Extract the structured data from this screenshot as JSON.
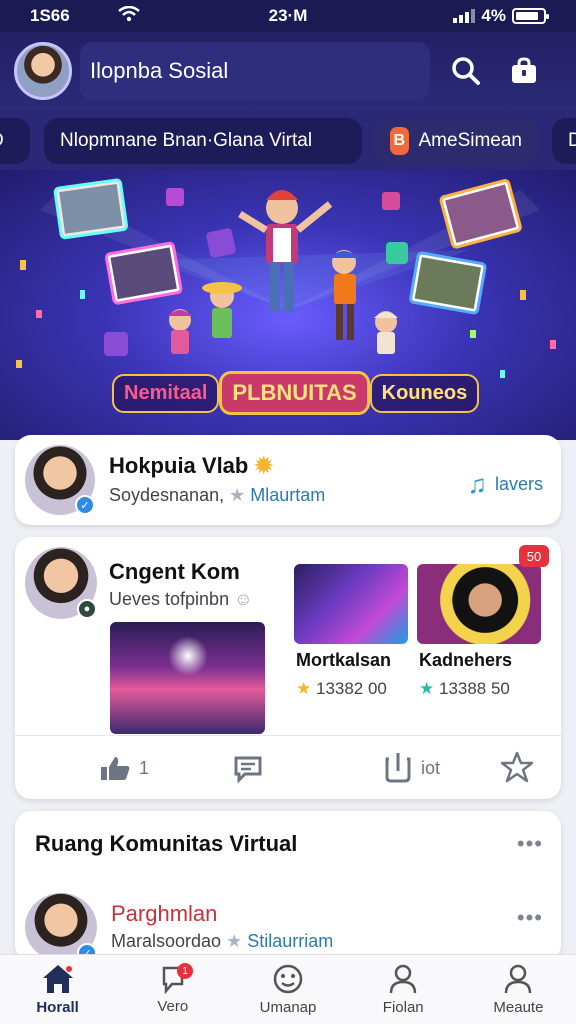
{
  "status": {
    "time": "1S66",
    "center": "23·M",
    "battery": "4%",
    "battery_level": 0.85
  },
  "header": {
    "search_text": "Ilopnba Sosial"
  },
  "chips": [
    {
      "label": "D"
    },
    {
      "label": "Nlopmnane Bnan·Glana Virtal"
    },
    {
      "label": "AmeSimean",
      "icon_text": "B"
    },
    {
      "label": "D"
    }
  ],
  "banner": {
    "left": "Nemitaal",
    "center": "PLBNUITAS",
    "right": "Kouneos"
  },
  "card1": {
    "name": "Hokpuia Vlab",
    "sub_a": "Soydesnanan,",
    "sub_b": "Mlaurtam",
    "action": "lavers"
  },
  "card2": {
    "name": "Cngent Kom",
    "sub": "Ueves tofpinbn",
    "badge": "50",
    "tiles": [
      {
        "label": "Mortkalsan",
        "stat": "13382 00"
      },
      {
        "label": "Kadnehers",
        "stat": "13388 50"
      }
    ],
    "actions": {
      "like_count": "1",
      "share_label": "iot"
    }
  },
  "card3": {
    "title": "Ruang Komunitas Virtual",
    "name": "Parghmlan",
    "sub_a": "Maralsoordao",
    "sub_b": "Stilaurriam"
  },
  "nav": [
    {
      "label": "Horall"
    },
    {
      "label": "Vero",
      "badge": "1"
    },
    {
      "label": "Umanap"
    },
    {
      "label": "Fiolan"
    },
    {
      "label": "Meaute"
    }
  ],
  "colors": {
    "header_bg": "#232064",
    "accent_blue": "#2a7ab0",
    "badge_red": "#e6323e"
  }
}
